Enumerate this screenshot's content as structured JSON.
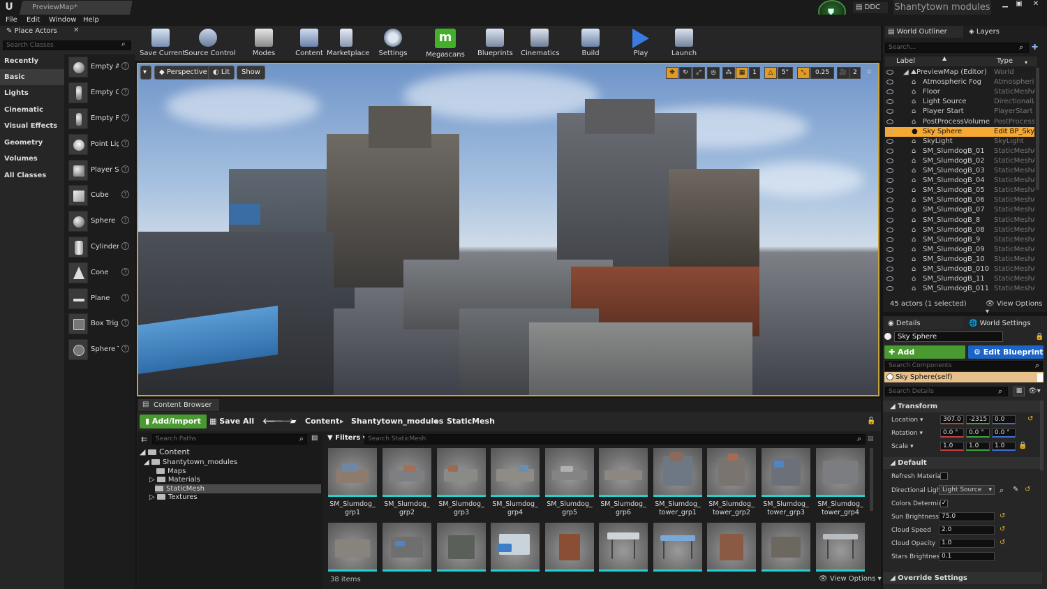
{
  "app": {
    "document_tab": "PreviewMap*",
    "ddc_label": "DDC",
    "project_name": "Shantytown modules"
  },
  "menu": [
    "File",
    "Edit",
    "Window",
    "Help"
  ],
  "place_actors": {
    "tab_label": "Place Actors",
    "search_placeholder": "Search Classes",
    "categories": [
      "Recently Placed",
      "Basic",
      "Lights",
      "Cinematic",
      "Visual Effects",
      "Geometry",
      "Volumes",
      "All Classes"
    ],
    "active_category": "Basic",
    "actors": [
      "Empty A",
      "Empty C",
      "Empty P",
      "Point Lig",
      "Player S",
      "Cube",
      "Sphere",
      "Cylinder",
      "Cone",
      "Plane",
      "Box Trig",
      "Sphere T"
    ]
  },
  "toolbar": {
    "buttons": [
      "Save Current",
      "Source Control",
      "Modes",
      "Content",
      "Marketplace",
      "Settings",
      "Megascans",
      "Blueprints",
      "Cinematics",
      "Build",
      "Play",
      "Launch"
    ],
    "colors": {
      "megascans": "#43b02a",
      "play": "#3a7be0"
    }
  },
  "viewport": {
    "perspective": "Perspective",
    "lit": "Lit",
    "show": "Show",
    "grid_value": "1",
    "rotation_snap": "5°",
    "scale_snap": "0.25",
    "camera_speed": "2"
  },
  "content_browser": {
    "tab_label": "Content Browser",
    "add_import": "Add/Import",
    "save_all": "Save All",
    "breadcrumb": [
      "Content",
      "Shantytown_modules",
      "StaticMesh"
    ],
    "paths_search_placeholder": "Search Paths",
    "filters_label": "Filters",
    "asset_search_placeholder": "Search StaticMesh",
    "tree": [
      {
        "label": "Content",
        "depth": 0
      },
      {
        "label": "Shantytown_modules",
        "depth": 1
      },
      {
        "label": "Maps",
        "depth": 2
      },
      {
        "label": "Materials",
        "depth": 2
      },
      {
        "label": "StaticMesh",
        "depth": 2
      },
      {
        "label": "Textures",
        "depth": 2
      }
    ],
    "selected_folder": "StaticMesh",
    "assets_row1": [
      [
        "SM_Slumdog_",
        "grp1"
      ],
      [
        "SM_Slumdog_",
        "grp2"
      ],
      [
        "SM_Slumdog_",
        "grp3"
      ],
      [
        "SM_Slumdog_",
        "grp4"
      ],
      [
        "SM_Slumdog_",
        "grp5"
      ],
      [
        "SM_Slumdog_",
        "grp6"
      ],
      [
        "SM_Slumdog_",
        "tower_grp1"
      ],
      [
        "SM_Slumdog_",
        "tower_grp2"
      ],
      [
        "SM_Slumdog_",
        "tower_grp3"
      ],
      [
        "SM_Slumdog_",
        "tower_grp4"
      ]
    ],
    "item_count": "38 items",
    "view_options": "View Options"
  },
  "outliner": {
    "tab_label": "World Outliner",
    "layers_tab": "Layers",
    "search_placeholder": "Search...",
    "col_label": "Label",
    "col_type": "Type",
    "rows": [
      {
        "label": "PreviewMap (Editor)",
        "type": "World"
      },
      {
        "label": "Atmospheric Fog",
        "type": "AtmosphericF"
      },
      {
        "label": "Floor",
        "type": "StaticMeshAc"
      },
      {
        "label": "Light Source",
        "type": "DirectionalLig"
      },
      {
        "label": "Player Start",
        "type": "PlayerStart"
      },
      {
        "label": "PostProcessVolume",
        "type": "PostProcessV"
      },
      {
        "label": "Sky Sphere",
        "type": "Edit BP_Sky_"
      },
      {
        "label": "SkyLight",
        "type": "SkyLight"
      },
      {
        "label": "SM_SlumdogB_01",
        "type": "StaticMeshAc"
      },
      {
        "label": "SM_SlumdogB_02",
        "type": "StaticMeshAc"
      },
      {
        "label": "SM_SlumdogB_03",
        "type": "StaticMeshAc"
      },
      {
        "label": "SM_SlumdogB_04",
        "type": "StaticMeshAc"
      },
      {
        "label": "SM_SlumdogB_05",
        "type": "StaticMeshAc"
      },
      {
        "label": "SM_SlumdogB_06",
        "type": "StaticMeshAc"
      },
      {
        "label": "SM_SlumdogB_07",
        "type": "StaticMeshAc"
      },
      {
        "label": "SM_SlumdogB_8",
        "type": "StaticMeshAc"
      },
      {
        "label": "SM_SlumdogB_08",
        "type": "StaticMeshAc"
      },
      {
        "label": "SM_SlumdogB_9",
        "type": "StaticMeshAc"
      },
      {
        "label": "SM_SlumdogB_09",
        "type": "StaticMeshAc"
      },
      {
        "label": "SM_SlumdogB_10",
        "type": "StaticMeshAc"
      },
      {
        "label": "SM_SlumdogB_010",
        "type": "StaticMeshAc"
      },
      {
        "label": "SM_SlumdogB_11",
        "type": "StaticMeshAc"
      },
      {
        "label": "SM_SlumdogB_011",
        "type": "StaticMeshAc"
      }
    ],
    "selected_row": "Sky Sphere",
    "footer": "45 actors (1 selected)",
    "view_options": "View Options"
  },
  "details": {
    "tab_label": "Details",
    "world_settings_tab": "World Settings",
    "actor_name": "Sky Sphere",
    "add_component": "Add Component",
    "edit_blueprint": "Edit Blueprint",
    "components_search_placeholder": "Search Components",
    "component_self": "Sky Sphere(self)",
    "details_search_placeholder": "Search Details",
    "transform_header": "Transform",
    "location_label": "Location",
    "location": [
      "307.0",
      "-2315",
      "0.0"
    ],
    "rotation_label": "Rotation",
    "rotation": [
      "0.0 °",
      "0.0 °",
      "0.0 °"
    ],
    "scale_label": "Scale",
    "scale": [
      "1.0",
      "1.0",
      "1.0"
    ],
    "default_header": "Default",
    "refresh_material_label": "Refresh Material",
    "directional_light_label": "Directional Light",
    "directional_light_value": "Light Source",
    "colors_determined_label": "Colors Determin",
    "sun_brightness_label": "Sun Brightness",
    "sun_brightness": "75.0",
    "cloud_speed_label": "Cloud Speed",
    "cloud_speed": "2.0",
    "cloud_opacity_label": "Cloud Opacity",
    "cloud_opacity": "1.0",
    "stars_brightness_label": "Stars Brightness",
    "stars_brightness": "0.1",
    "override_header": "Override Settings"
  }
}
